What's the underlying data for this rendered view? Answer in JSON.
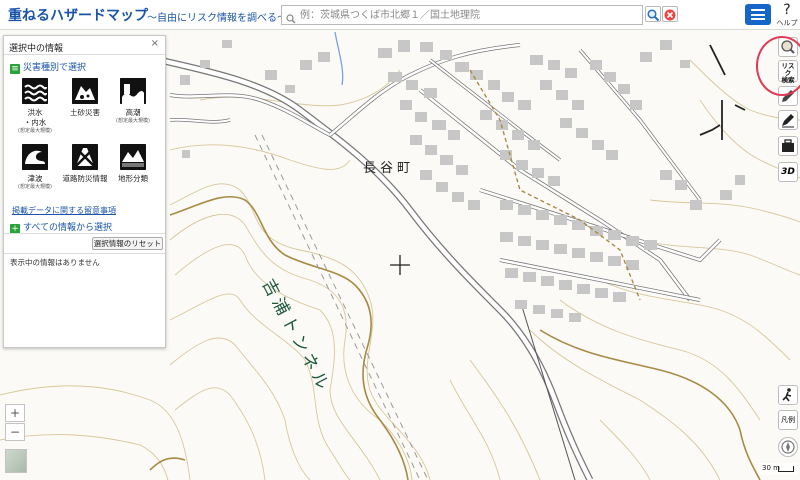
{
  "header": {
    "title": "重ねるハザードマップ",
    "subtitle": "～自由にリスク情報を調べる～",
    "search_placeholder": "例：茨城県つくば市北郷１／国土地理院",
    "help_label": "ヘルプ"
  },
  "panel": {
    "title": "選択中の情報",
    "section_hazard": "災害種別で選択",
    "hazards": [
      {
        "label": "洪水\n・内水",
        "sub": "(想定最大規模)",
        "icon": "flood-icon"
      },
      {
        "label": "土砂災害",
        "sub": "",
        "icon": "landslide-icon"
      },
      {
        "label": "高潮",
        "sub": "(想定最大規模)",
        "icon": "storm-surge-icon"
      },
      {
        "label": "津波",
        "sub": "(想定最大規模)",
        "icon": "tsunami-icon"
      },
      {
        "label": "道路防災情報",
        "sub": "",
        "icon": "road-hazard-icon"
      },
      {
        "label": "地形分類",
        "sub": "",
        "icon": "landform-icon"
      }
    ],
    "notes_link": "掲載データに関する留意事項",
    "section_all": "すべての情報から選択",
    "reset_label": "選択情報のリセット",
    "empty_text": "表示中の情報はありません"
  },
  "map": {
    "town_label": "長谷町",
    "tunnel_label": "吉浦トンネル",
    "scale_label": "30 m",
    "legend_label": "凡例"
  },
  "toolbar": {
    "risk_label_line1": "リスク",
    "risk_label_line2": "検索",
    "three_d_label": "3D"
  },
  "colors": {
    "brand": "#1a54a8",
    "accent_green": "#2aa23a",
    "contour": "#c8b27a",
    "contour_index": "#a0813a",
    "building": "#c7c7c7",
    "highlight": "#e03a55",
    "tunnel_label": "#1f5a3e"
  }
}
